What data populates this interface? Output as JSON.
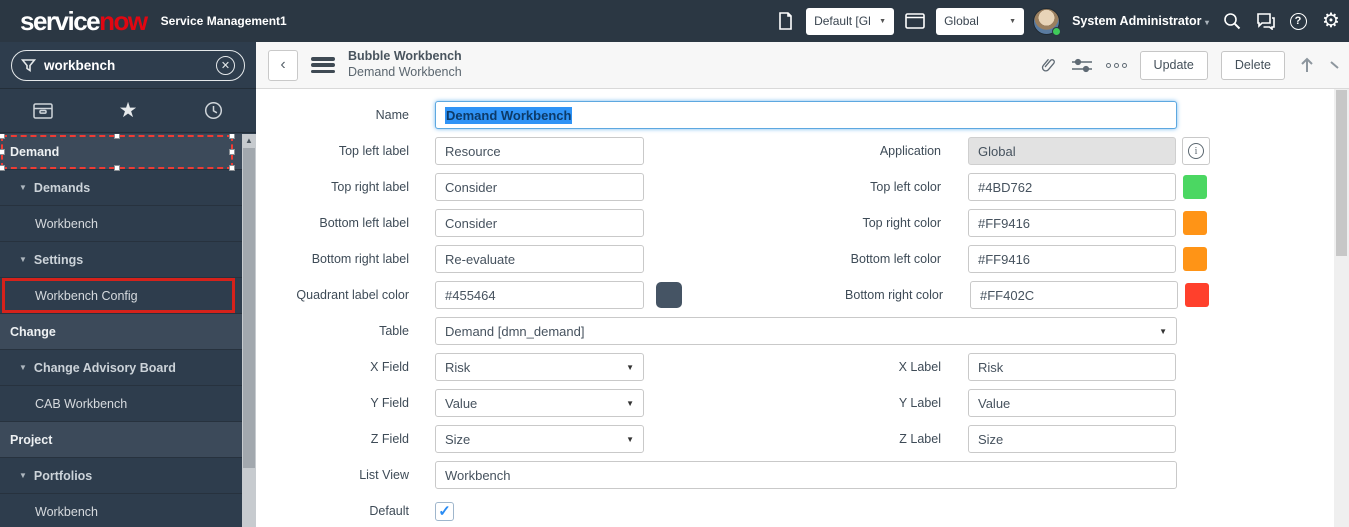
{
  "banner": {
    "logo_part1": "service",
    "logo_part2": "now",
    "app_name": "Service Management1",
    "update_set_selector": "Default [Gl",
    "scope_selector": "Global",
    "user_name": "System Administrator"
  },
  "sidebar": {
    "filter": {
      "value": "workbench"
    },
    "items": {
      "demand": {
        "label": "Demand"
      },
      "demands": {
        "label": "Demands"
      },
      "workbench1": {
        "label": "Workbench"
      },
      "settings": {
        "label": "Settings"
      },
      "workbench_config": {
        "label": "Workbench Config"
      },
      "change": {
        "label": "Change"
      },
      "cab": {
        "label": "Change Advisory Board"
      },
      "cab_workbench": {
        "label": "CAB Workbench"
      },
      "project": {
        "label": "Project"
      },
      "portfolios": {
        "label": "Portfolios"
      },
      "workbench2": {
        "label": "Workbench"
      }
    }
  },
  "form_header": {
    "title": "Bubble Workbench",
    "subtitle": "Demand Workbench",
    "update_label": "Update",
    "delete_label": "Delete"
  },
  "form": {
    "name": {
      "label": "Name",
      "value": "Demand Workbench"
    },
    "top_left_label": {
      "label": "Top left label",
      "value": "Resource"
    },
    "application": {
      "label": "Application",
      "value": "Global"
    },
    "top_right_label": {
      "label": "Top right label",
      "value": "Consider"
    },
    "top_left_color": {
      "label": "Top left color",
      "value": "#4BD762"
    },
    "bottom_left_label": {
      "label": "Bottom left label",
      "value": "Consider"
    },
    "top_right_color": {
      "label": "Top right color",
      "value": "#FF9416"
    },
    "bottom_right_label": {
      "label": "Bottom right label",
      "value": "Re-evaluate"
    },
    "bottom_left_color": {
      "label": "Bottom left color",
      "value": "#FF9416"
    },
    "quadrant_label_color": {
      "label": "Quadrant label color",
      "value": "#455464"
    },
    "bottom_right_color": {
      "label": "Bottom right color",
      "value": "#FF402C"
    },
    "table": {
      "label": "Table",
      "value": "Demand [dmn_demand]"
    },
    "x_field": {
      "label": "X Field",
      "value": "Risk"
    },
    "x_label": {
      "label": "X Label",
      "value": "Risk"
    },
    "y_field": {
      "label": "Y Field",
      "value": "Value"
    },
    "y_label": {
      "label": "Y Label",
      "value": "Value"
    },
    "z_field": {
      "label": "Z Field",
      "value": "Size"
    },
    "z_label": {
      "label": "Z Label",
      "value": "Size"
    },
    "list_view": {
      "label": "List View",
      "value": "Workbench"
    },
    "default": {
      "label": "Default"
    }
  },
  "icons": {
    "expanded_triangle": "▼",
    "select_caret": "▼",
    "star": "★",
    "gear": "⚙",
    "check": "✓",
    "clear": "✕",
    "help": "?",
    "info": "i",
    "back": "‹",
    "dropdown_caret": "▼"
  }
}
